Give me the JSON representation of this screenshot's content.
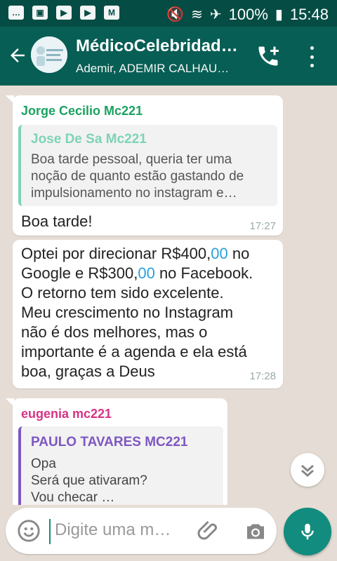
{
  "status": {
    "battery": "100%",
    "time": "15:48"
  },
  "header": {
    "title": "MédicoCelebridad…",
    "subtitle": "Ademir, ADEMIR CALHAU…"
  },
  "messages": [
    {
      "sender": "Jorge Cecilio Mc221",
      "quote": {
        "name": "Jose De Sa Mc221",
        "text_lines": [
          "Boa tarde pessoal, queria ter uma",
          "noção de quanto estão gastando de",
          "impulsionamento no instagram e…"
        ]
      },
      "text": "Boa tarde!",
      "time": "17:27"
    },
    {
      "text_lines": [
        [
          "Optei por direcionar R$400,",
          "00",
          " no"
        ],
        [
          "Google e R$300,",
          "00",
          " no Facebook."
        ],
        [
          "O retorno tem sido excelente."
        ],
        [
          "Meu crescimento no Instagram"
        ],
        [
          "não é dos melhores, mas o"
        ],
        [
          "importante é a agenda e ela está"
        ],
        [
          "boa, graças a Deus"
        ]
      ],
      "time": "17:28"
    },
    {
      "sender": "eugenia mc221",
      "quote": {
        "name": "PAULO TAVARES MC221",
        "text_lines": [
          "Opa",
          "Será que ativaram?",
          "Vou checar …"
        ]
      }
    }
  ],
  "composer": {
    "placeholder": "Digite uma m…"
  },
  "colors": {
    "appbar": "#075e54",
    "statusbar": "#054d44",
    "sender1": "#1aa260",
    "sender3": "#d63384",
    "quote1": "#7fd3b8",
    "quote2": "#7e57c2",
    "accent": "#128c7e",
    "link": "#2aa0dc"
  }
}
